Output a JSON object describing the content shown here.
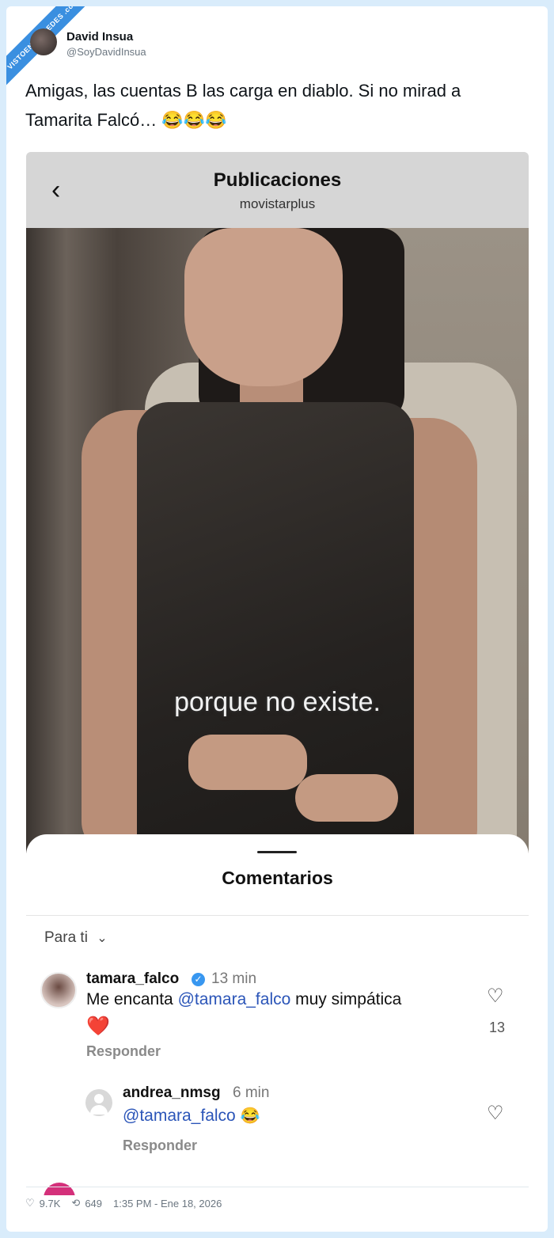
{
  "watermark": "VISTOENLASREDES .com",
  "tweet": {
    "author_name": "David Insua",
    "author_handle": "@SoyDavidInsua",
    "text": "Amigas, las cuentas B las carga en diablo. Si no mirad a Tamarita Falcó… 😂😂😂",
    "likes": "9.7K",
    "retweets": "649",
    "timestamp": "1:35 PM - Ene 18, 2026"
  },
  "instagram": {
    "header_title": "Publicaciones",
    "header_subtitle": "movistarplus",
    "video_subtitle": "porque no existe.",
    "comments_title": "Comentarios",
    "filter_label": "Para ti",
    "comments": [
      {
        "user": "tamara_falco",
        "verified": true,
        "time": "13 min",
        "text_before": "Me encanta ",
        "mention": "@tamara_falco",
        "text_after": " muy simpática",
        "emoji": "❤️",
        "reply_label": "Responder",
        "likes": "13"
      },
      {
        "user": "andrea_nmsg",
        "time": "6 min",
        "mention": "@tamara_falco",
        "emoji": "😂",
        "reply_label": "Responder"
      }
    ]
  },
  "icons": {
    "back": "chevron-left-icon",
    "filter": "chevron-down-icon",
    "like": "heart-outline-icon",
    "verified": "verified-badge-icon",
    "tweet_like": "heart-icon",
    "tweet_retweet": "retweet-icon"
  },
  "colors": {
    "mention": "#2b55b8",
    "verified": "#3897f0",
    "ribbon": "#3a8fe0"
  }
}
